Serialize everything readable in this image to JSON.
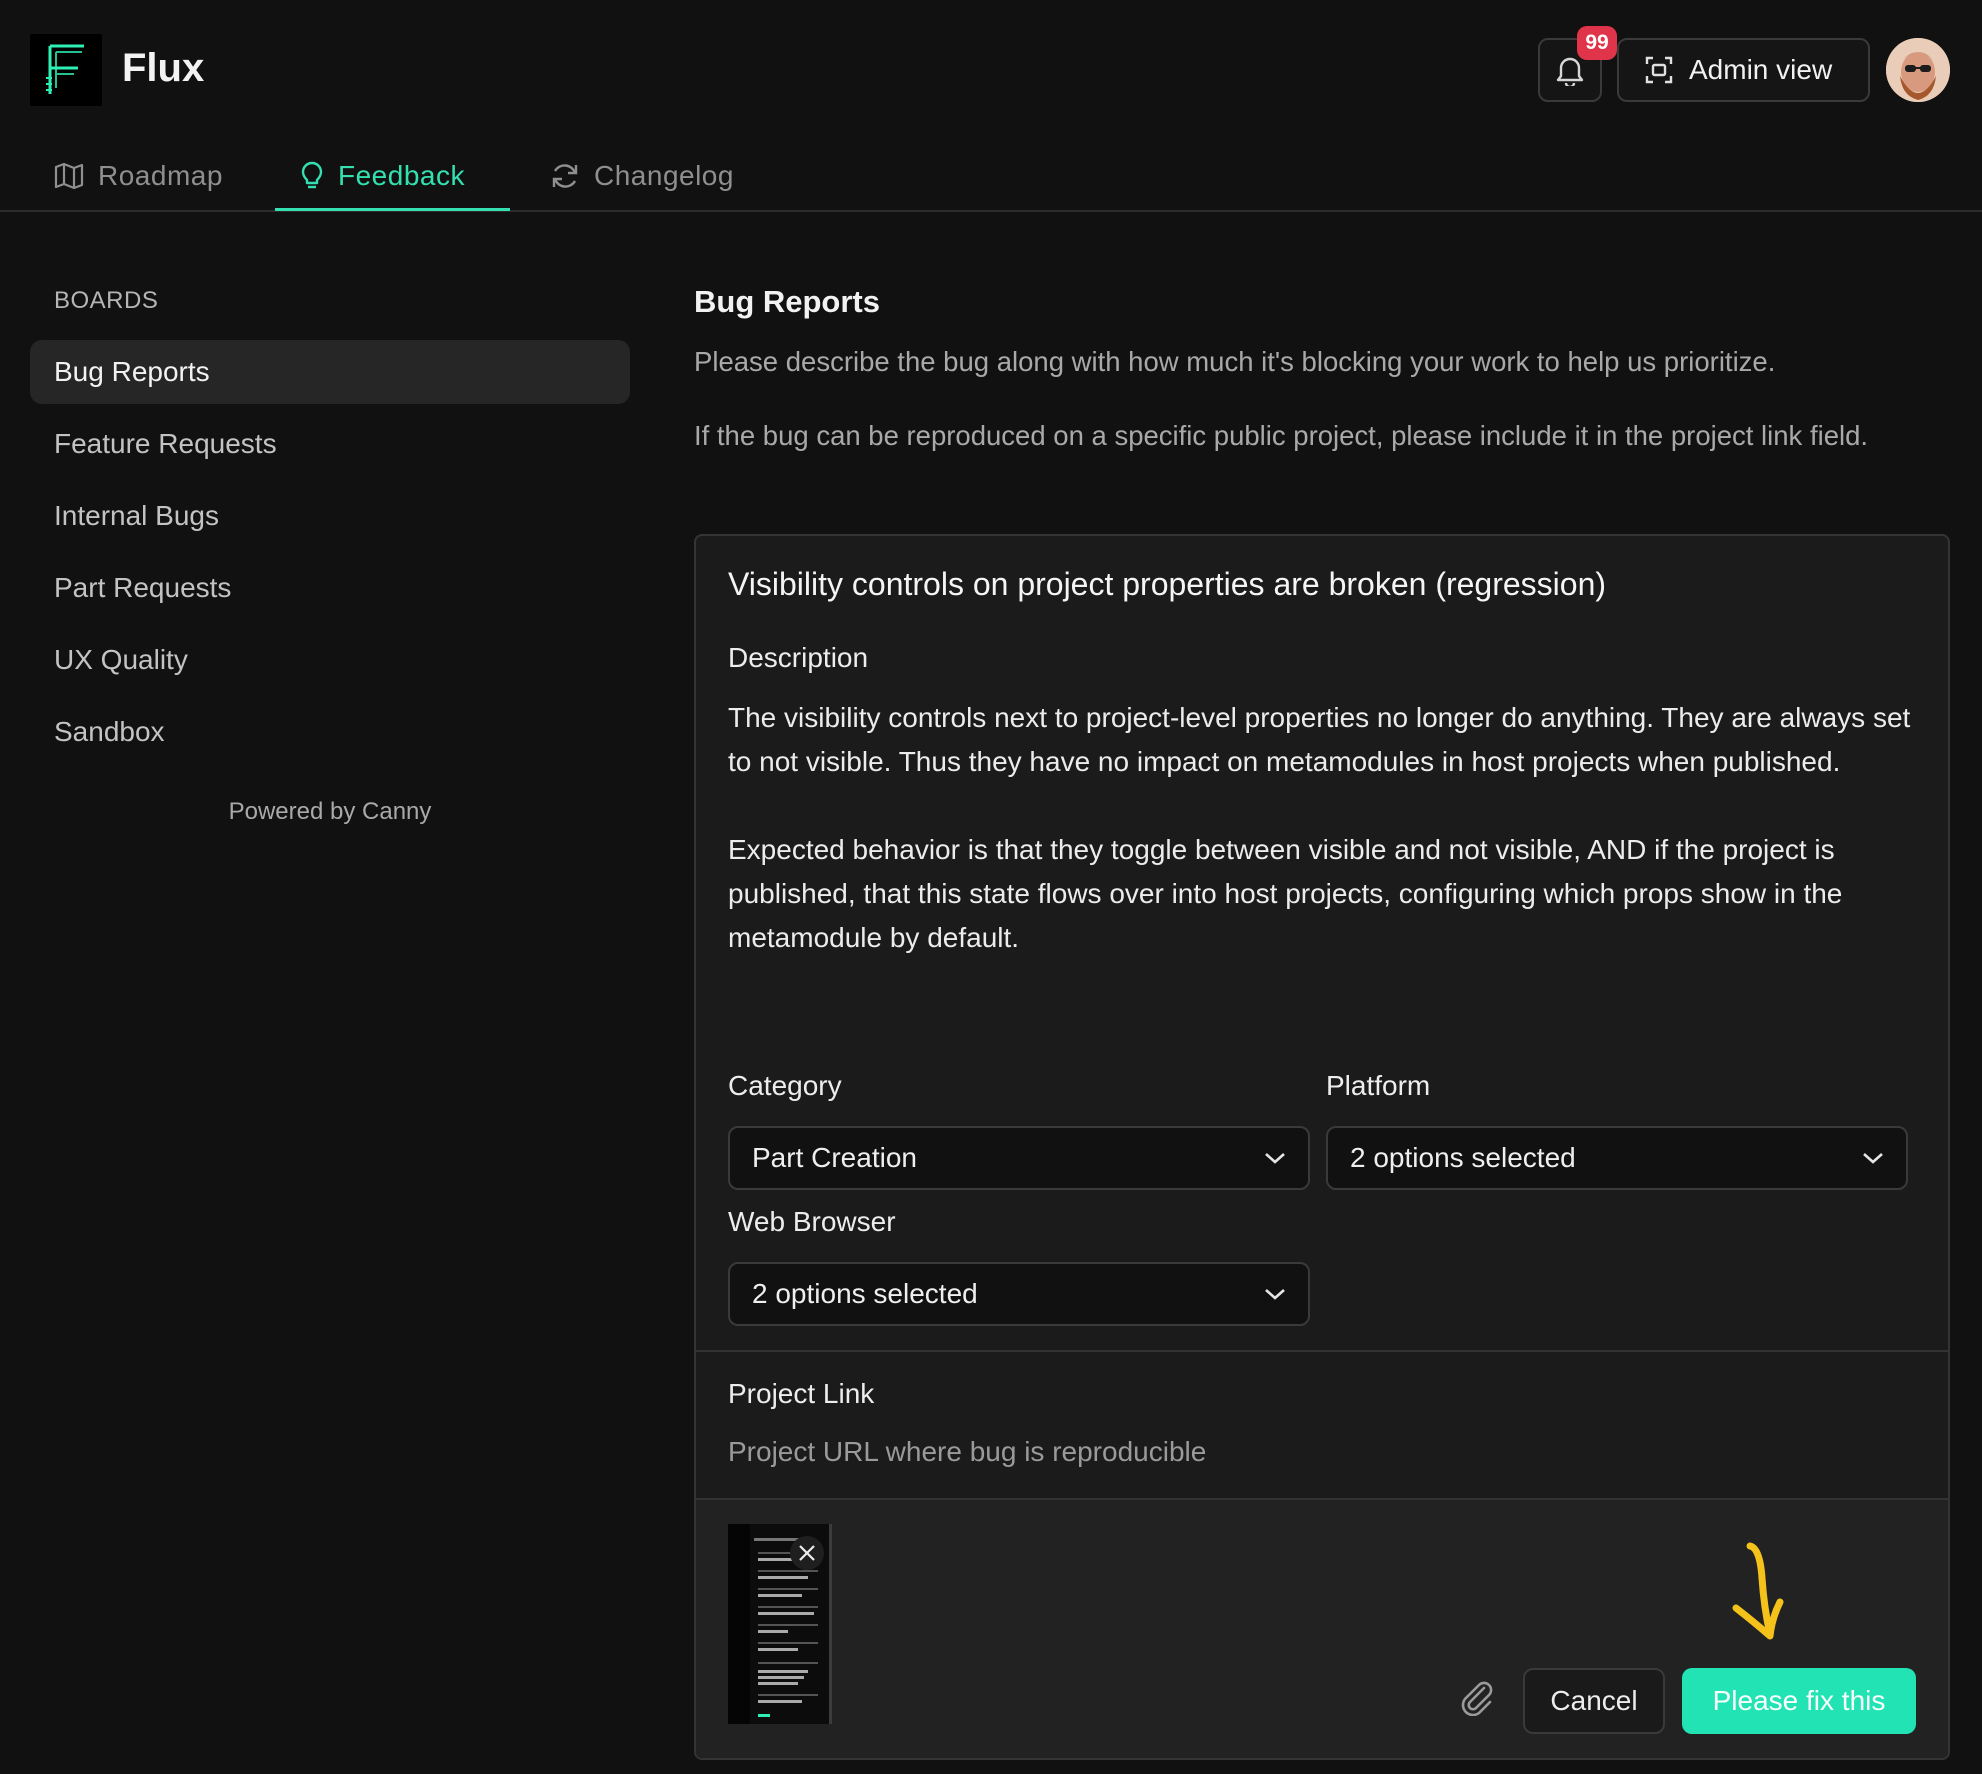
{
  "app": {
    "name": "Flux"
  },
  "header": {
    "notification_count": "99",
    "admin_label": "Admin view"
  },
  "tabs": [
    {
      "label": "Roadmap",
      "icon": "map-icon"
    },
    {
      "label": "Feedback",
      "icon": "lightbulb-icon",
      "active": true
    },
    {
      "label": "Changelog",
      "icon": "refresh-icon"
    }
  ],
  "sidebar": {
    "title": "BOARDS",
    "items": [
      {
        "label": "Bug Reports",
        "active": true
      },
      {
        "label": "Feature Requests"
      },
      {
        "label": "Internal Bugs"
      },
      {
        "label": "Part Requests"
      },
      {
        "label": "UX Quality"
      },
      {
        "label": "Sandbox"
      }
    ],
    "powered_by": "Powered by Canny"
  },
  "board": {
    "title": "Bug Reports",
    "description_1": "Please describe the bug along with how much it's blocking your work to help us prioritize.",
    "description_2": "If the bug can be reproduced on a specific public project, please include it in the project link field."
  },
  "post": {
    "title": "Visibility controls on project properties are broken (regression)",
    "description_label": "Description",
    "description_p1": "The visibility controls next to project-level properties no longer do anything. They are always set to not visible. Thus they have no impact on metamodules in host projects when published.",
    "description_p2": "Expected behavior is that they toggle between visible and not visible, AND if the project is published, that this state flows over into host projects, configuring which props show in the metamodule by default.",
    "category_label": "Category",
    "category_value": "Part Creation",
    "platform_label": "Platform",
    "platform_value": "2 options selected",
    "browser_label": "Web Browser",
    "browser_value": "2 options selected",
    "project_link_label": "Project Link",
    "project_link_placeholder": "Project URL where bug is reproducible"
  },
  "actions": {
    "cancel": "Cancel",
    "submit": "Please fix this"
  },
  "colors": {
    "accent": "#35e0b0",
    "submit": "#22e3b4",
    "badge": "#e0344b",
    "background": "#111111",
    "arrow": "#f5c21b"
  }
}
